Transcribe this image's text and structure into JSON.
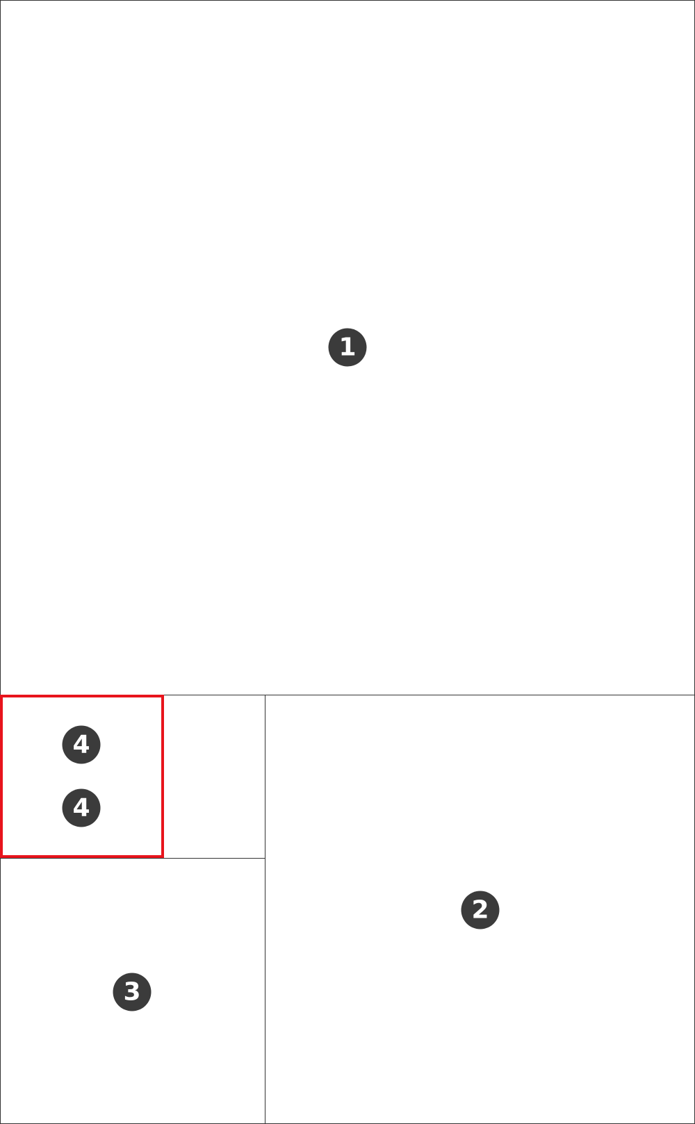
{
  "figure": {
    "panels": [
      {
        "id": "panel-1",
        "badge": "1"
      },
      {
        "id": "panel-2",
        "badge": "2"
      },
      {
        "id": "panel-3",
        "badge": "3"
      },
      {
        "id": "panel-4",
        "badges": [
          "4",
          "4"
        ]
      }
    ],
    "colors": {
      "line": "#333333",
      "badge_fill": "#3b3b3b",
      "badge_text": "#ffffff",
      "highlight": "#e8141c",
      "background": "#ffffff"
    }
  }
}
